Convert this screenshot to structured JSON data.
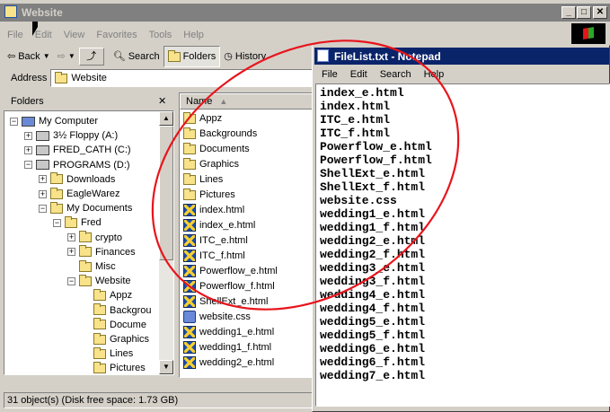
{
  "explorer": {
    "title": "Website",
    "menu": [
      "File",
      "Edit",
      "View",
      "Favorites",
      "Tools",
      "Help"
    ],
    "toolbar": {
      "back": "Back",
      "search": "Search",
      "folders": "Folders",
      "history": "History"
    },
    "address_label": "Address",
    "address_value": "Website",
    "folders_pane_title": "Folders",
    "close_glyph": "✕",
    "tree": [
      {
        "label": "My Computer",
        "icon": "computer-icon",
        "level": 0,
        "expander": "−"
      },
      {
        "label": "3½ Floppy (A:)",
        "icon": "floppy-icon",
        "level": 1,
        "expander": "+"
      },
      {
        "label": "FRED_CATH (C:)",
        "icon": "drive-icon",
        "level": 1,
        "expander": "+"
      },
      {
        "label": "PROGRAMS (D:)",
        "icon": "drive-icon",
        "level": 1,
        "expander": "−"
      },
      {
        "label": "Downloads",
        "icon": "folder-icon",
        "level": 2,
        "expander": "+"
      },
      {
        "label": "EagleWarez",
        "icon": "folder-icon",
        "level": 2,
        "expander": "+"
      },
      {
        "label": "My Documents",
        "icon": "folder-icon",
        "level": 2,
        "expander": "−"
      },
      {
        "label": "Fred",
        "icon": "folder-icon",
        "level": 3,
        "expander": "−"
      },
      {
        "label": "crypto",
        "icon": "folder-icon",
        "level": 4,
        "expander": "+"
      },
      {
        "label": "Finances",
        "icon": "folder-icon",
        "level": 4,
        "expander": "+"
      },
      {
        "label": "Misc",
        "icon": "folder-icon",
        "level": 4,
        "expander": ""
      },
      {
        "label": "Website",
        "icon": "folder-icon",
        "level": 4,
        "expander": "−"
      },
      {
        "label": "Appz",
        "icon": "folder-icon",
        "level": 5,
        "expander": ""
      },
      {
        "label": "Backgrou",
        "icon": "folder-icon",
        "level": 5,
        "expander": ""
      },
      {
        "label": "Docume",
        "icon": "folder-icon",
        "level": 5,
        "expander": ""
      },
      {
        "label": "Graphics",
        "icon": "folder-icon",
        "level": 5,
        "expander": ""
      },
      {
        "label": "Lines",
        "icon": "folder-icon",
        "level": 5,
        "expander": ""
      },
      {
        "label": "Pictures",
        "icon": "folder-icon",
        "level": 5,
        "expander": ""
      }
    ],
    "files_header": "Name",
    "files": [
      {
        "name": "Appz",
        "icon": "folder-icon"
      },
      {
        "name": "Backgrounds",
        "icon": "folder-icon"
      },
      {
        "name": "Documents",
        "icon": "folder-icon"
      },
      {
        "name": "Graphics",
        "icon": "folder-icon"
      },
      {
        "name": "Lines",
        "icon": "folder-icon"
      },
      {
        "name": "Pictures",
        "icon": "folder-icon"
      },
      {
        "name": "index.html",
        "icon": "html-file-icon"
      },
      {
        "name": "index_e.html",
        "icon": "html-file-icon"
      },
      {
        "name": "ITC_e.html",
        "icon": "html-file-icon"
      },
      {
        "name": "ITC_f.html",
        "icon": "html-file-icon"
      },
      {
        "name": "Powerflow_e.html",
        "icon": "html-file-icon"
      },
      {
        "name": "Powerflow_f.html",
        "icon": "html-file-icon"
      },
      {
        "name": "ShellExt_e.html",
        "icon": "html-file-icon"
      },
      {
        "name": "website.css",
        "icon": "css-file-icon"
      },
      {
        "name": "wedding1_e.html",
        "icon": "html-file-icon"
      },
      {
        "name": "wedding1_f.html",
        "icon": "html-file-icon"
      },
      {
        "name": "wedding2_e.html",
        "icon": "html-file-icon"
      }
    ],
    "status": "31 object(s) (Disk free space: 1.73 GB)"
  },
  "notepad": {
    "title": "FileList.txt - Notepad",
    "menu": [
      "File",
      "Edit",
      "Search",
      "Help"
    ],
    "lines": [
      "index_e.html",
      "index.html",
      "ITC_e.html",
      "ITC_f.html",
      "Powerflow_e.html",
      "Powerflow_f.html",
      "ShellExt_e.html",
      "ShellExt_f.html",
      "website.css",
      "wedding1_e.html",
      "wedding1_f.html",
      "wedding2_e.html",
      "wedding2_f.html",
      "wedding3_e.html",
      "wedding3_f.html",
      "wedding4_e.html",
      "wedding4_f.html",
      "wedding5_e.html",
      "wedding5_f.html",
      "wedding6_e.html",
      "wedding6_f.html",
      "wedding7_e.html"
    ]
  },
  "colors": {
    "annotation": "#e8141c",
    "active_title": "#0a246a",
    "inactive_title": "#808080"
  }
}
